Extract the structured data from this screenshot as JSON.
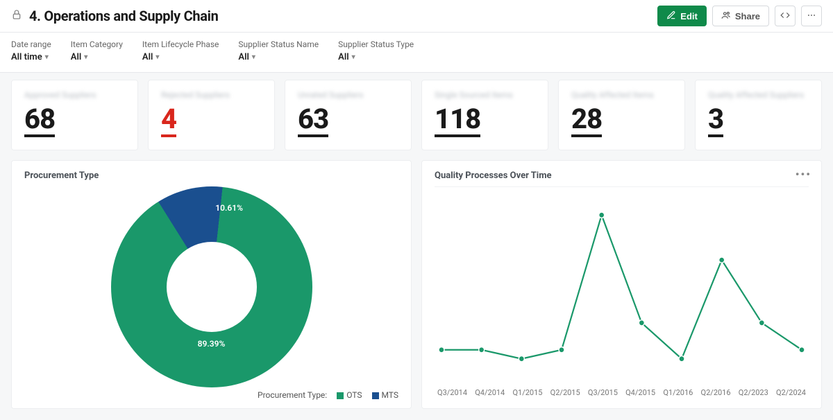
{
  "header": {
    "title": "4. Operations and Supply Chain",
    "edit_label": "Edit",
    "share_label": "Share"
  },
  "filters": [
    {
      "label": "Date range",
      "value": "All time"
    },
    {
      "label": "Item Category",
      "value": "All"
    },
    {
      "label": "Item Lifecycle Phase",
      "value": "All"
    },
    {
      "label": "Supplier Status Name",
      "value": "All"
    },
    {
      "label": "Supplier Status Type",
      "value": "All"
    }
  ],
  "metrics": [
    {
      "label": "Approved Suppliers",
      "value": "68",
      "accent": "default"
    },
    {
      "label": "Rejected Suppliers",
      "value": "4",
      "accent": "red"
    },
    {
      "label": "Unrated Suppliers",
      "value": "63",
      "accent": "default"
    },
    {
      "label": "Single Sourced Items",
      "value": "118",
      "accent": "default"
    },
    {
      "label": "Quality Affected Items",
      "value": "28",
      "accent": "default"
    },
    {
      "label": "Quality Affected Suppliers",
      "value": "3",
      "accent": "default"
    }
  ],
  "donut": {
    "title": "Procurement Type",
    "legend_title": "Procurement Type:",
    "series": [
      {
        "name": "OTS",
        "value": 89.39,
        "label": "89.39%",
        "color": "#1a986a"
      },
      {
        "name": "MTS",
        "value": 10.61,
        "label": "10.61%",
        "color": "#1a4f8f"
      }
    ]
  },
  "line": {
    "title": "Quality Processes Over Time",
    "categories": [
      "Q3/2014",
      "Q4/2014",
      "Q1/2015",
      "Q2/2015",
      "Q3/2015",
      "Q4/2015",
      "Q1/2016",
      "Q2/2016",
      "Q2/2023",
      "Q2/2024"
    ]
  },
  "chart_data": [
    {
      "type": "pie",
      "title": "Procurement Type",
      "series": [
        {
          "name": "OTS",
          "value": 89.39
        },
        {
          "name": "MTS",
          "value": 10.61
        }
      ],
      "legend": [
        "OTS",
        "MTS"
      ]
    },
    {
      "type": "line",
      "title": "Quality Processes Over Time",
      "categories": [
        "Q3/2014",
        "Q4/2014",
        "Q1/2015",
        "Q2/2015",
        "Q3/2015",
        "Q4/2015",
        "Q1/2016",
        "Q2/2016",
        "Q2/2023",
        "Q2/2024"
      ],
      "series": [
        {
          "name": "Quality Processes",
          "values": [
            3,
            3,
            2,
            3,
            18,
            6,
            2,
            13,
            6,
            3
          ]
        }
      ],
      "xlabel": "",
      "ylabel": "",
      "ylim": [
        0,
        20
      ]
    }
  ]
}
